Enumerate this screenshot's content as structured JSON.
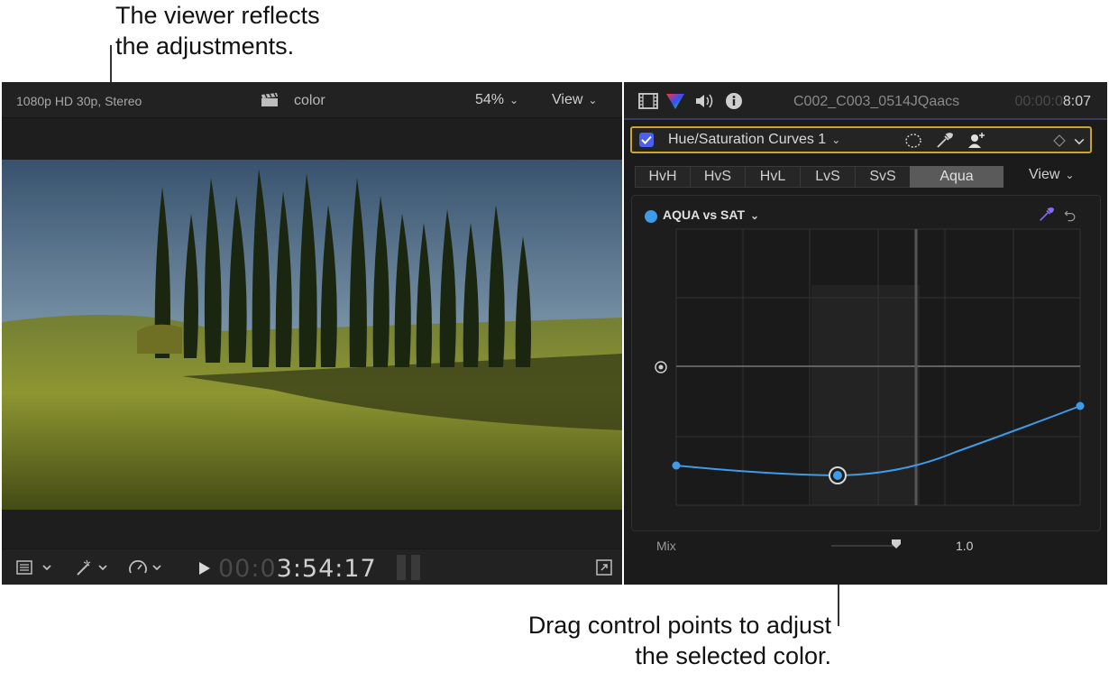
{
  "callouts": {
    "top": [
      "The viewer reflects",
      "the adjustments."
    ],
    "bottom": [
      "Drag control points to adjust",
      "the selected color."
    ]
  },
  "viewer": {
    "format": "1080p HD 30p, Stereo",
    "title": "color",
    "zoom": "54%",
    "view_label": "View",
    "timecode_dim": "00:0",
    "timecode_bright": "3:54:17"
  },
  "inspector": {
    "clip_name": "C002_C003_0514JQaacs",
    "clip_time_dim": "00:00:0",
    "clip_time_bright": "8:07",
    "effect_name": "Hue/Saturation Curves 1",
    "tabs": [
      {
        "label": "HvH"
      },
      {
        "label": "HvS"
      },
      {
        "label": "HvL"
      },
      {
        "label": "LvS"
      },
      {
        "label": "SvS"
      },
      {
        "label": "Aqua"
      }
    ],
    "view_label": "View",
    "curve_name": "AQUA vs SAT",
    "mix_label": "Mix",
    "mix_value": "1.0"
  },
  "colors": {
    "curve": "#3d9be9",
    "highlight_border": "#c8a530",
    "checkbox": "#4b5ff0"
  }
}
